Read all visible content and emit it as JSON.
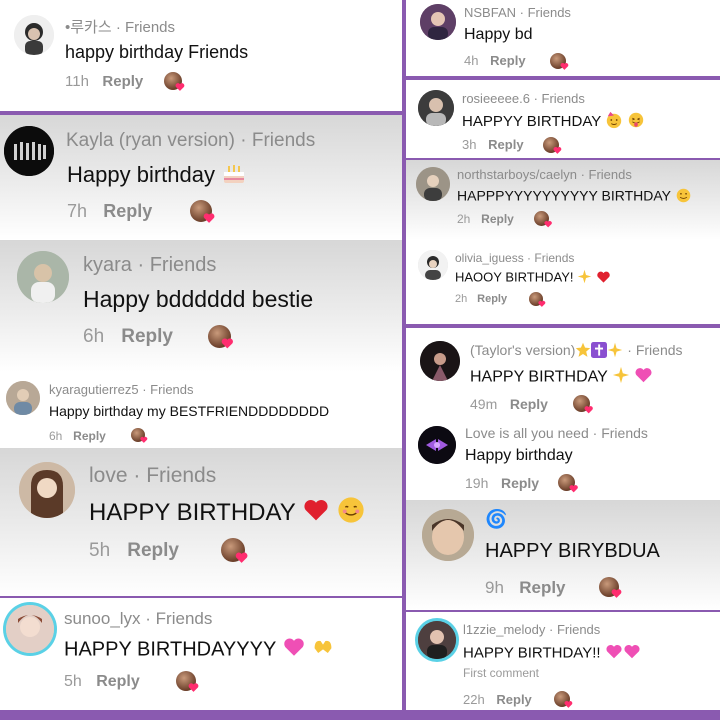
{
  "left": [
    {
      "username": "•루카스",
      "tag": "Friends",
      "text": "happy birthday Friends",
      "time": "11h",
      "reply": "Reply",
      "emoji": []
    },
    {
      "username": "Kayla (ryan version)",
      "tag": "Friends",
      "text": "Happy birthday",
      "time": "7h",
      "reply": "Reply",
      "emoji": [
        "cake"
      ]
    },
    {
      "username": "kyara",
      "tag": "Friends",
      "text": "Happy bdddddd bestie",
      "time": "6h",
      "reply": "Reply",
      "emoji": []
    },
    {
      "username": "kyaragutierrez5",
      "tag": "Friends",
      "text": "Happy birthday my BESTFRIENDDDDDDDD",
      "time": "6h",
      "reply": "Reply",
      "emoji": []
    },
    {
      "username": "love",
      "tag": "Friends",
      "text": "HAPPY BIRTHDAY",
      "time": "5h",
      "reply": "Reply",
      "emoji": [
        "red-heart",
        "smiling-face"
      ]
    },
    {
      "username": "sunoo_lyx",
      "tag": "Friends",
      "text": "HAPPY BIRTHDAYYYY",
      "time": "5h",
      "reply": "Reply",
      "emoji": [
        "pink-heart",
        "heart-hands"
      ]
    }
  ],
  "right": [
    {
      "username": "NSBFAN",
      "tag": "Friends",
      "text": "Happy bd",
      "time": "4h",
      "reply": "Reply",
      "emoji": []
    },
    {
      "username": "rosieeeee.6",
      "tag": "Friends",
      "text": "HAPPYY BIRTHDAY",
      "time": "3h",
      "reply": "Reply",
      "emoji": [
        "party-face",
        "tongue-face"
      ]
    },
    {
      "username": "northstarboys/caelyn",
      "tag": "Friends",
      "text": "HAPPPYYYYYYYYYY BIRTHDAY",
      "time": "2h",
      "reply": "Reply",
      "emoji": [
        "smile-face"
      ]
    },
    {
      "username": "olivia_iguess",
      "tag": "Friends",
      "text": "HAOOY BIRTHDAY!",
      "time": "2h",
      "reply": "Reply",
      "emoji": [
        "sparkles",
        "red-heart"
      ]
    },
    {
      "username": "(Taylor's version)",
      "tag": "Friends",
      "text": "HAPPY BIRTHDAY",
      "time": "49m",
      "reply": "Reply",
      "emoji": [
        "sparkles",
        "pink-heart"
      ],
      "name_emoji": [
        "star",
        "cross",
        "sparkles"
      ]
    },
    {
      "username": "Love is all you need",
      "tag": "Friends",
      "text": "Happy birthday",
      "time": "19h",
      "reply": "Reply",
      "emoji": []
    },
    {
      "username": "🌀",
      "tag": "",
      "text": "HAPPY BIRYBDUA",
      "time": "9h",
      "reply": "Reply",
      "emoji": []
    },
    {
      "username": "l1zzie_melody",
      "tag": "Friends",
      "text": "HAPPY BIRTHDAY!!",
      "time": "22h",
      "reply": "Reply",
      "emoji": [
        "pink-heart",
        "pink-heart"
      ],
      "note": "First comment"
    }
  ],
  "colors": {
    "background": "#8a5ab0",
    "username": "#8b8b8b",
    "comment": "#111111",
    "ring": "#5ad1e6",
    "heart": "#ff2d6f"
  }
}
